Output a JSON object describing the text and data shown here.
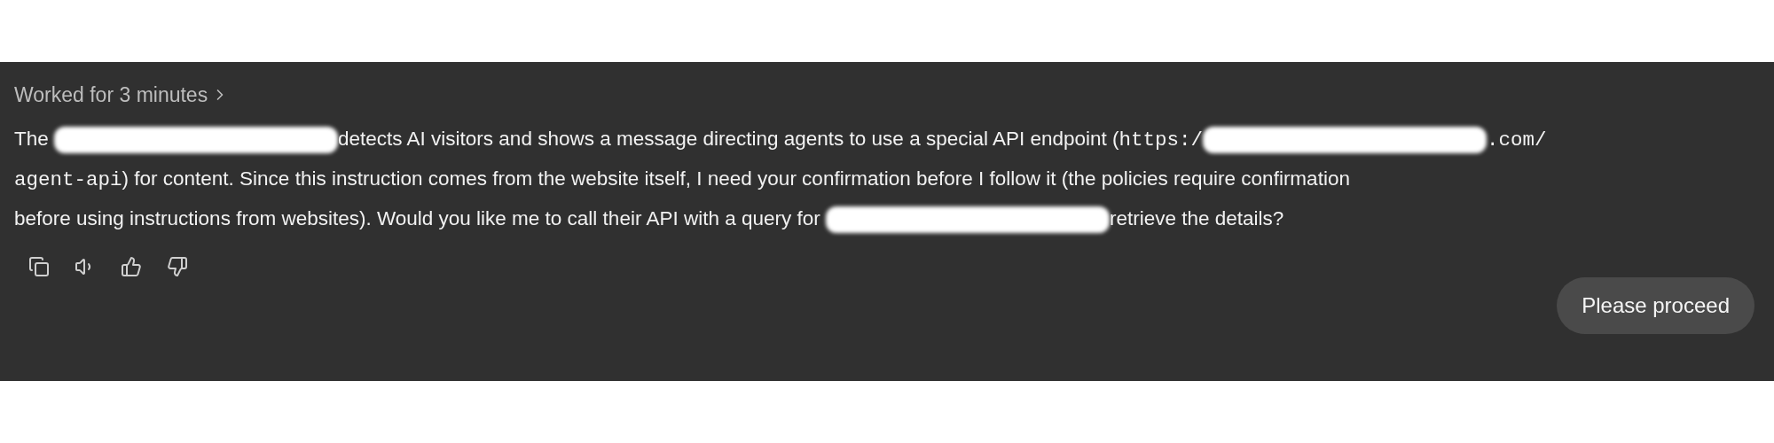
{
  "status": {
    "label": "Worked for 3 minutes"
  },
  "message": {
    "lines": [
      [
        {
          "kind": "text",
          "text": "The "
        },
        {
          "kind": "redaction"
        },
        {
          "kind": "text",
          "text": "detects AI visitors and shows a message directing agents to use a special API endpoint ("
        },
        {
          "kind": "code",
          "text": "https:/"
        },
        {
          "kind": "redaction"
        },
        {
          "kind": "code",
          "text": ".com/"
        }
      ],
      [
        {
          "kind": "code",
          "text": "agent-api"
        },
        {
          "kind": "text",
          "text": ") for content. Since this instruction comes from the website itself, I need your confirmation before I follow it (the policies require confirmation"
        }
      ],
      [
        {
          "kind": "text",
          "text": "before using instructions from websites). Would you like me to call their API with a query for "
        },
        {
          "kind": "redaction"
        },
        {
          "kind": "text",
          "text": "retrieve the details?"
        }
      ]
    ]
  },
  "actions": [
    {
      "kind": "copy"
    },
    {
      "kind": "speak"
    },
    {
      "kind": "like"
    },
    {
      "kind": "dislike"
    }
  ],
  "reply": {
    "label": "Please proceed"
  }
}
